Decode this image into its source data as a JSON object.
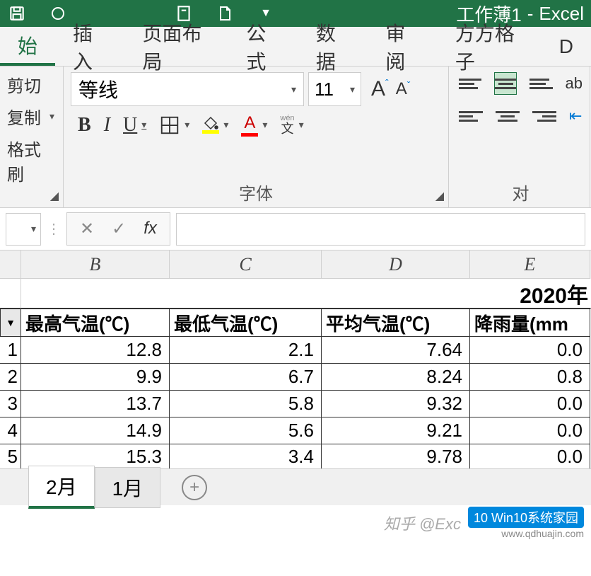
{
  "title_bar": {
    "workbook_label": "工作薄1",
    "separator": "-",
    "app_name": "Excel"
  },
  "ribbon": {
    "tabs": [
      "始",
      "插入",
      "页面布局",
      "公式",
      "数据",
      "审阅",
      "方方格子",
      "D"
    ],
    "active_tab": 0,
    "clipboard": {
      "cut": "剪切",
      "copy": "复制",
      "format_painter": "格式刷"
    },
    "font": {
      "name": "等线",
      "size": "11",
      "group_label": "字体",
      "pinyin": "文"
    },
    "align": {
      "group_label": "对",
      "wrap": "ab"
    }
  },
  "formula_bar": {
    "fx": "fx"
  },
  "sheet": {
    "title": "2020年",
    "columns": [
      "B",
      "C",
      "D",
      "E"
    ],
    "headers": [
      "最高气温(℃)",
      "最低气温(℃)",
      "平均气温(℃)",
      "降雨量(mm"
    ],
    "rows": [
      {
        "num": "1",
        "cells": [
          "12.8",
          "2.1",
          "7.64",
          "0.0"
        ]
      },
      {
        "num": "2",
        "cells": [
          "9.9",
          "6.7",
          "8.24",
          "0.8"
        ]
      },
      {
        "num": "3",
        "cells": [
          "13.7",
          "5.8",
          "9.32",
          "0.0"
        ]
      },
      {
        "num": "4",
        "cells": [
          "14.9",
          "5.6",
          "9.21",
          "0.0"
        ]
      },
      {
        "num": "5",
        "cells": [
          "15.3",
          "3.4",
          "9.78",
          "0.0"
        ]
      }
    ]
  },
  "sheet_tabs": {
    "tabs": [
      "2月",
      "1月"
    ],
    "active": 0
  },
  "watermark": {
    "zhihu": "知乎 @Exc",
    "logo": "10 Win10系统家园",
    "site": "www.qdhuajin.com"
  }
}
